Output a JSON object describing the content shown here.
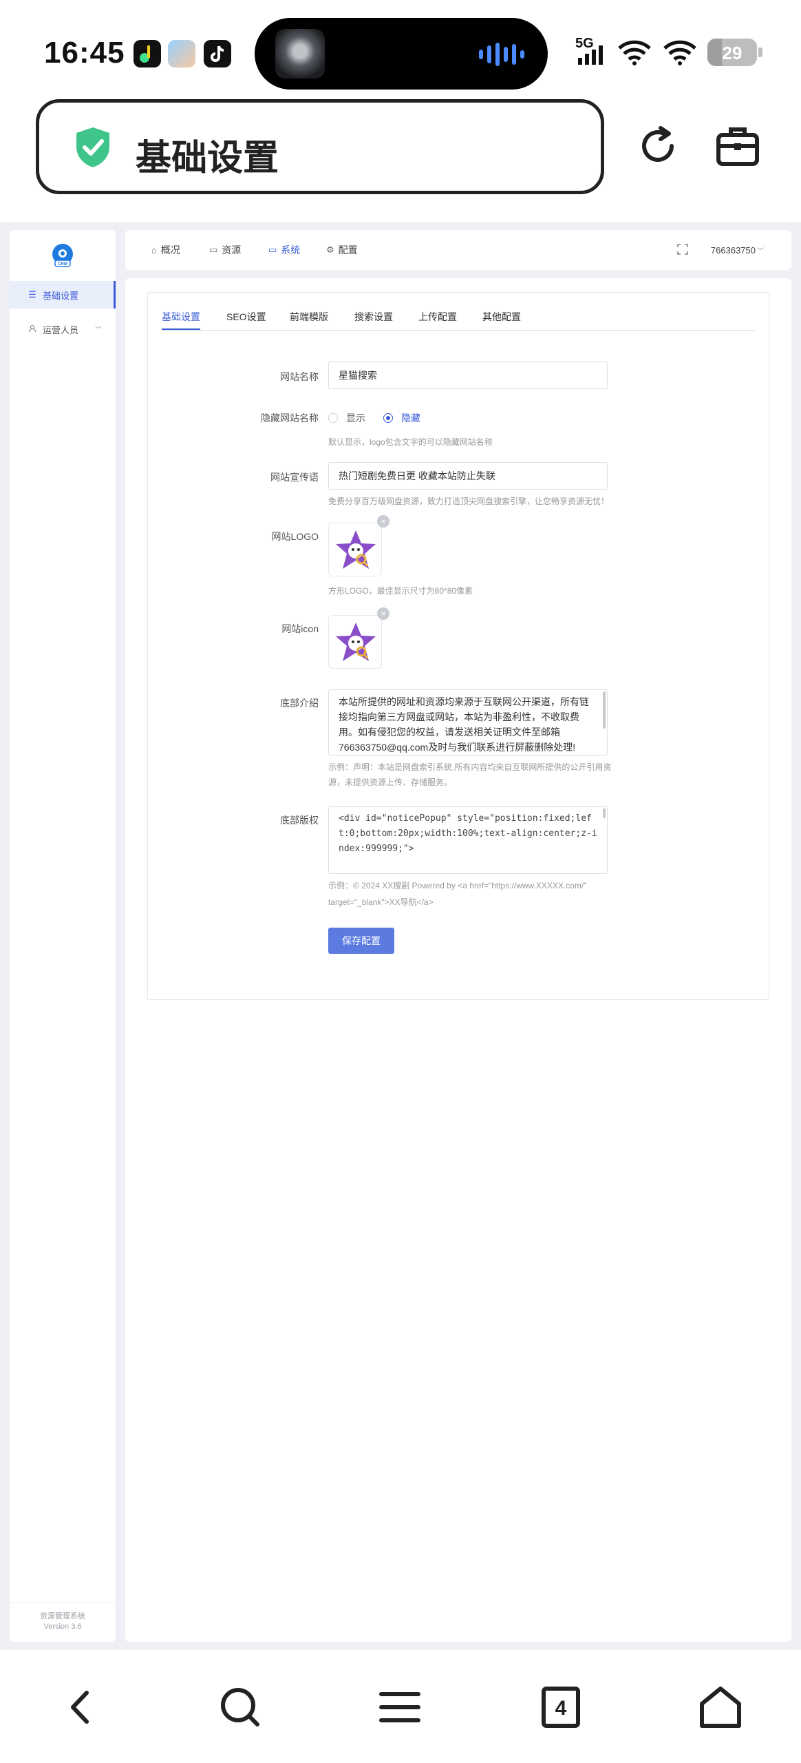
{
  "statusbar": {
    "time": "16:45",
    "network": "5G",
    "battery": "29",
    "battery_level": 0.29
  },
  "header": {
    "title": "基础设置"
  },
  "sidebar": {
    "items": [
      {
        "label": "基础设置"
      },
      {
        "label": "运营人员"
      }
    ],
    "footer_name": "资源管理系统",
    "footer_version": "Version 3.6"
  },
  "topnav": {
    "items": [
      {
        "label": "概况"
      },
      {
        "label": "资源"
      },
      {
        "label": "系统"
      },
      {
        "label": "配置"
      }
    ],
    "user": "766363750"
  },
  "tabs": [
    "基础设置",
    "SEO设置",
    "前端模版",
    "搜索设置",
    "上传配置",
    "其他配置"
  ],
  "form": {
    "site_name": {
      "label": "网站名称",
      "value": "星猫搜索"
    },
    "hide_name": {
      "label": "隐藏网站名称",
      "options": [
        "显示",
        "隐藏"
      ],
      "selected": "隐藏",
      "help": "默认显示，logo包含文字的可以隐藏网站名称"
    },
    "slogan": {
      "label": "网站宣传语",
      "value": "热门短剧免费日更 收藏本站防止失联",
      "help": "免费分享百万级网盘资源，致力打造顶尖网盘搜索引擎，让您畅享资源无忧！"
    },
    "logo": {
      "label": "网站LOGO",
      "help": "方形LOGO，最佳显示尺寸为80*80像素"
    },
    "icon": {
      "label": "网站icon"
    },
    "footer_intro": {
      "label": "底部介绍",
      "value": "本站所提供的网址和资源均来源于互联网公开渠道，所有链接均指向第三方网盘或网站，本站为非盈利性，不收取费用。如有侵犯您的权益，请发送相关证明文件至邮箱766363750@qq.com及时与我们联系进行屏蔽删除处理!",
      "help_line1": "示例：声明：本站是网盘索引系统,所有内容均来自互联网所提供的公开引用资",
      "help_line2": "源，未提供资源上传、存储服务。"
    },
    "footer_copyright": {
      "label": "底部版权",
      "value": "<div id=\"noticePopup\" style=\"position:fixed;left:0;bottom:20px;width:100%;text-align:center;z-index:999999;\">",
      "help_line1": "示例：© 2024 XX搜剧 Powered by <a href=\"https://www.XXXXX.com/\"",
      "help_line2": "target=\"_blank\">XX导航</a>"
    },
    "save_label": "保存配置"
  },
  "colors": {
    "accent": "#3a5bd6",
    "button": "#5b7be0",
    "page_bg": "#eef0f5"
  }
}
